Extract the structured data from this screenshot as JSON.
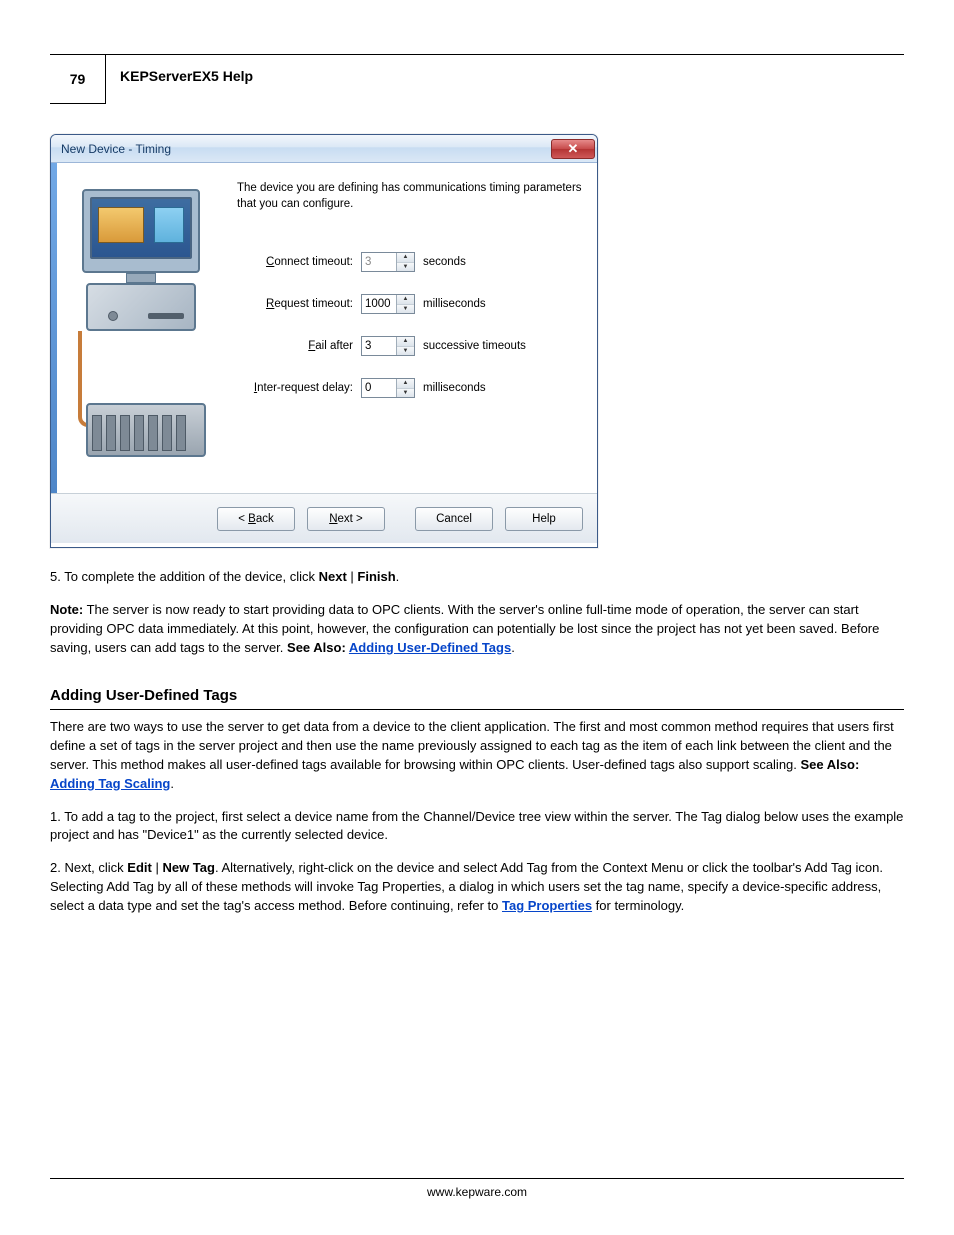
{
  "header": {
    "page_number": "79",
    "title": "KEPServerEX5 Help"
  },
  "dialog": {
    "title": "New Device - Timing",
    "intro": "The device you are defining has communications timing parameters that you can configure.",
    "rows": [
      {
        "label_pre": "",
        "label_accel": "C",
        "label_post": "onnect timeout:",
        "value": "3",
        "unit": "seconds",
        "disabled": true
      },
      {
        "label_pre": "",
        "label_accel": "R",
        "label_post": "equest timeout:",
        "value": "1000",
        "unit": "milliseconds",
        "disabled": false
      },
      {
        "label_pre": "",
        "label_accel": "F",
        "label_post": "ail after",
        "value": "3",
        "unit": "successive timeouts",
        "disabled": false
      },
      {
        "label_pre": "",
        "label_accel": "I",
        "label_post": "nter-request delay:",
        "value": "0",
        "unit": "milliseconds",
        "disabled": false
      }
    ],
    "buttons": {
      "back_pre": "< ",
      "back_accel": "B",
      "back_post": "ack",
      "next_pre": "",
      "next_accel": "N",
      "next_post": "ext >",
      "cancel": "Cancel",
      "help": "Help"
    }
  },
  "doc": {
    "step5_pre": "5. To complete the addition of the device, click ",
    "step5_b1": "Next",
    "step5_mid": " | ",
    "step5_b2": "Finish",
    "step5_post": ".",
    "note_label": "Note:",
    "note_body": " The server is now ready to start providing data to OPC clients. With the server's online full-time mode of operation, the server can start providing OPC data immediately. At this point, however, the configuration can potentially be lost since the project has not yet been saved. Before saving, users can add tags to the server. ",
    "see_also": "See Also: ",
    "link1": "Adding User-Defined Tags",
    "heading": "Adding User-Defined Tags",
    "para1_pre": "There are two ways to use the server to get data from a device to the client application. The first and most common method requires that users first define a set of tags in the server project and then use the name previously assigned to each tag as the item of each link between the client and the server. This method makes all user-defined tags available for browsing within OPC clients. User-defined tags also support scaling. ",
    "para1_see": "See Also: ",
    "para1_link": "Adding Tag Scaling",
    "para2": "1. To add a tag to the project, first select a device name from the Channel/Device tree view within the server. The Tag dialog below uses the example project and has \"Device1\" as the currently selected device.",
    "para3_pre": "2. Next, click ",
    "para3_b1": "Edit",
    "para3_mid1": " | ",
    "para3_b2": "New Tag",
    "para3_post1": ". Alternatively, right-click on the device and select Add Tag from the Context Menu or click the toolbar's Add Tag icon. Selecting Add Tag by all of these methods will invoke Tag Properties, a dialog in which users set the tag name, specify a device-specific address, select a data type and set the tag's access method. Before continuing, refer to ",
    "para3_link": "Tag Properties",
    "para3_post2": " for terminology."
  },
  "footer": {
    "url": "www.kepware.com"
  }
}
